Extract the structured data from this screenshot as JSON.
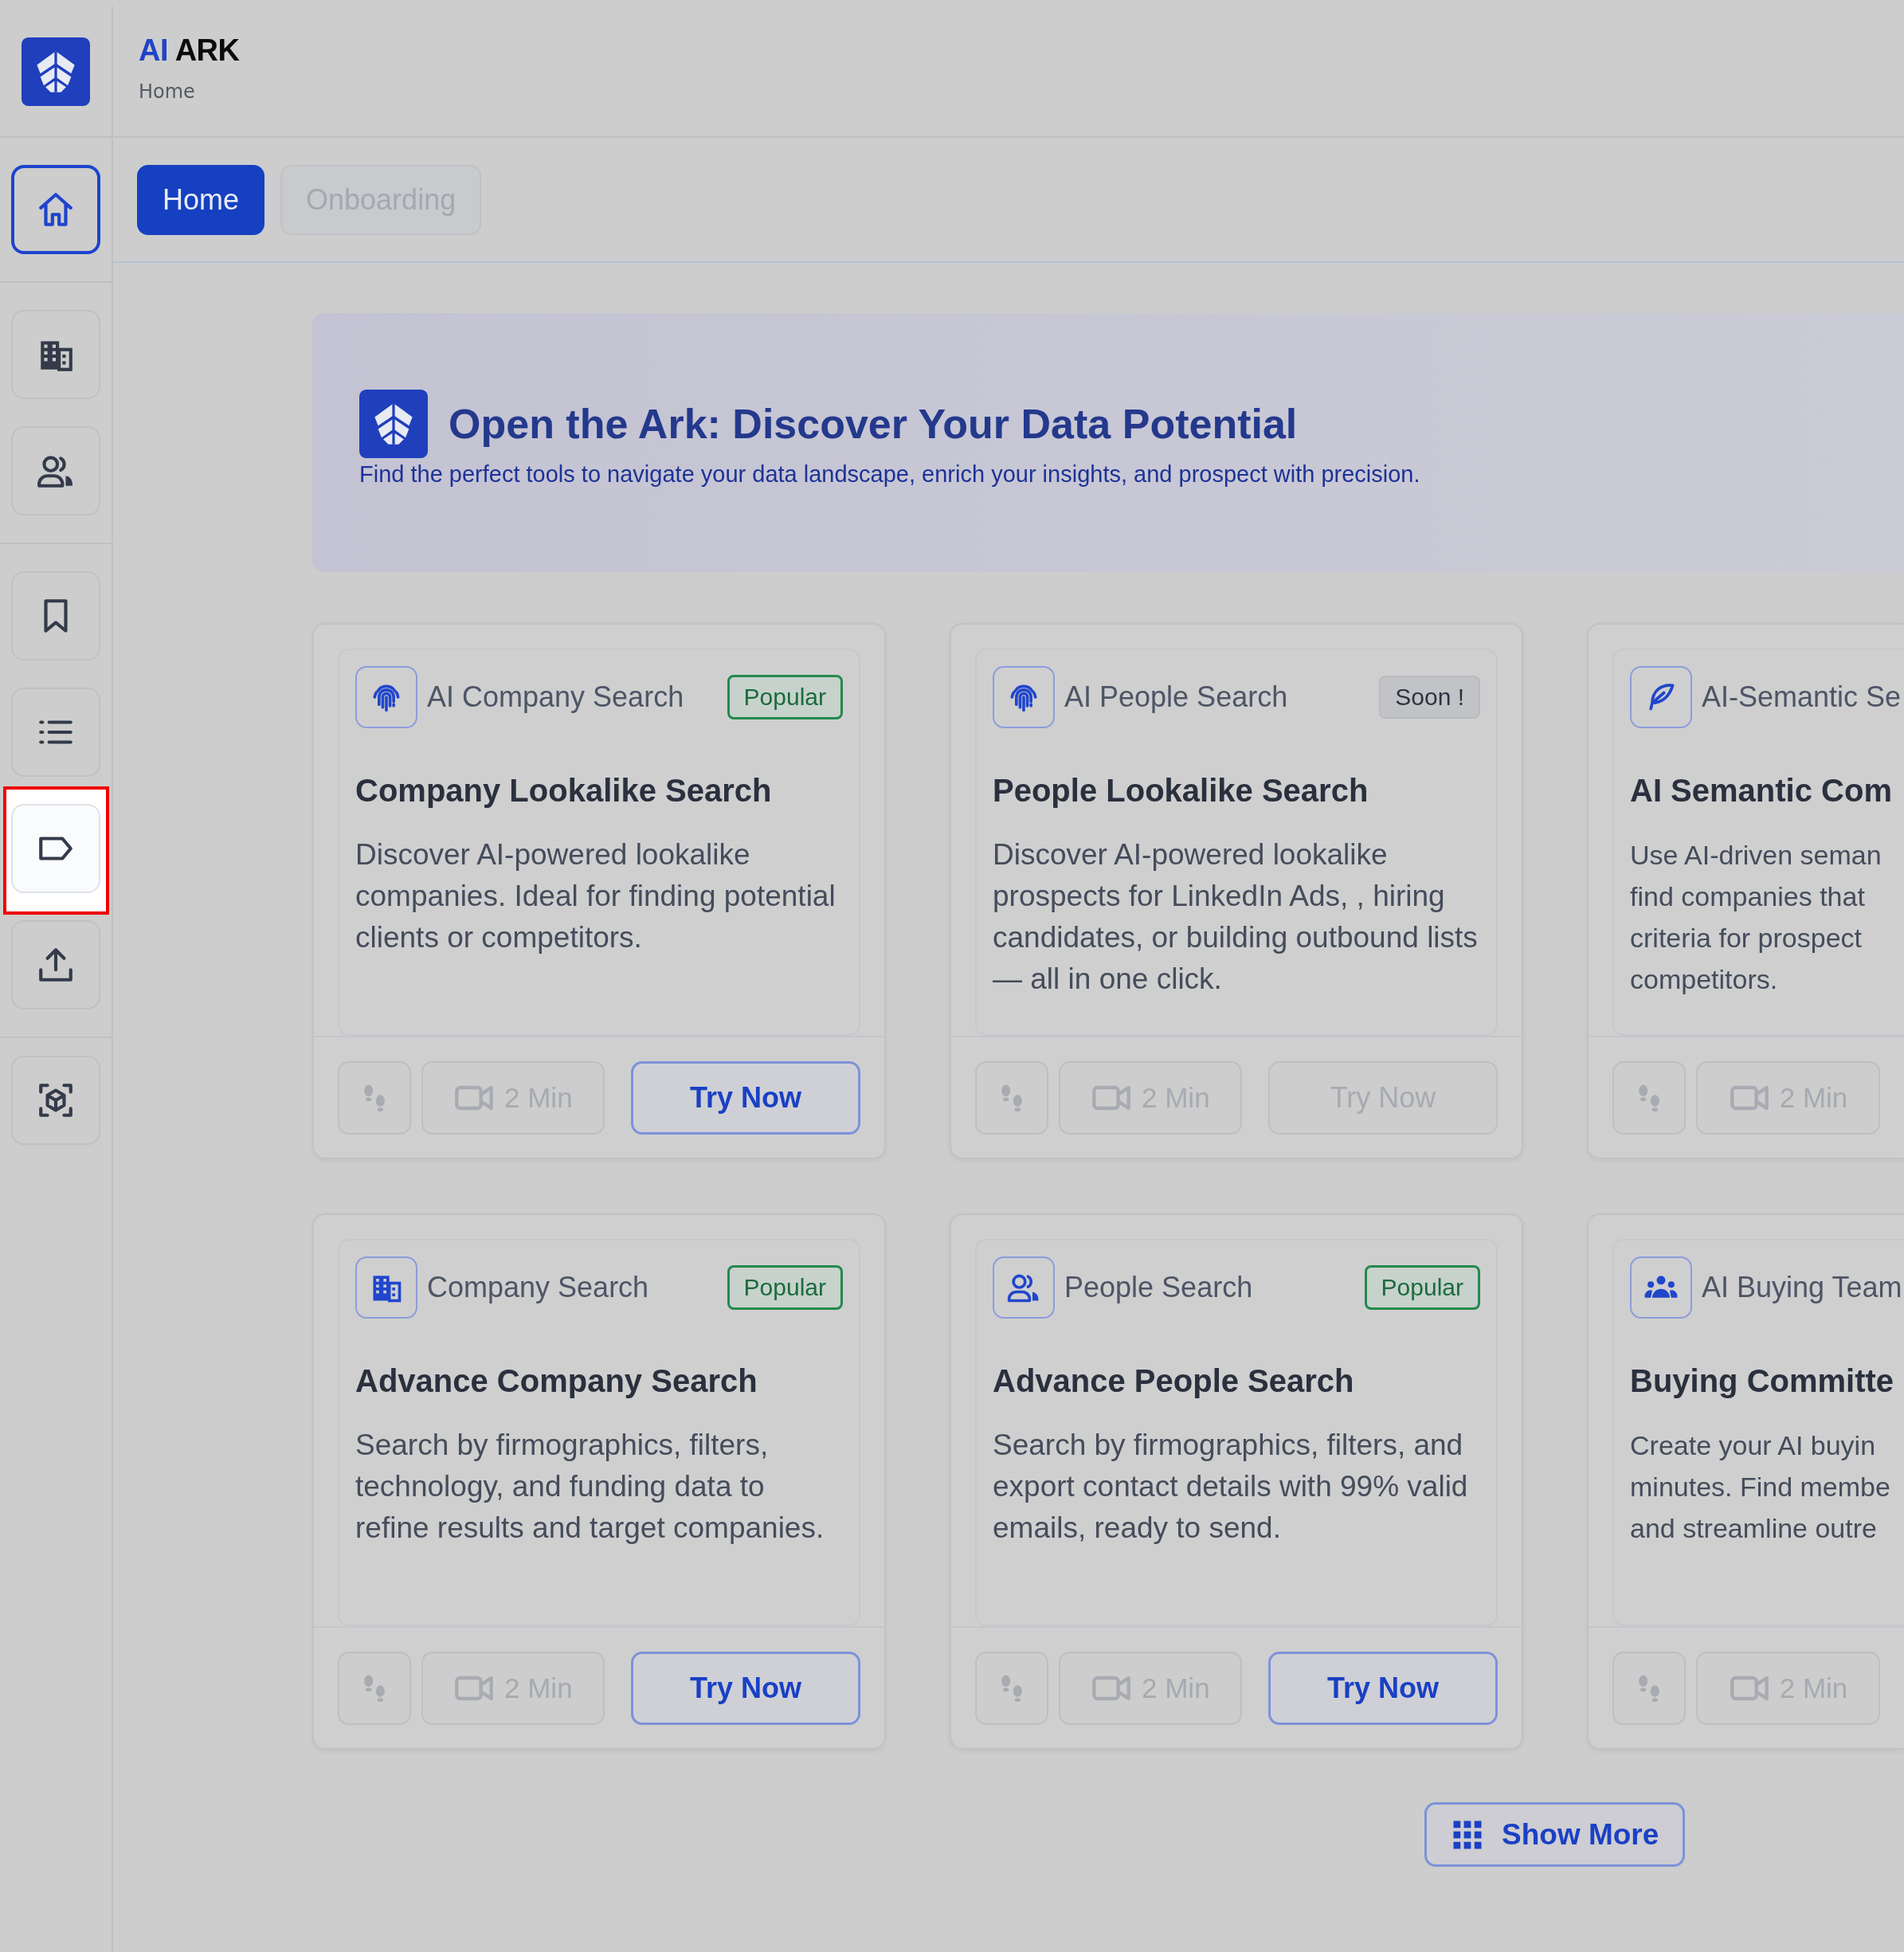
{
  "app": {
    "brand_prefix": "AI",
    "brand_name": "ARK",
    "breadcrumb": "Home"
  },
  "sidebar": {
    "groups": [
      {
        "items": [
          {
            "selected": true,
            "highlighted": false
          }
        ]
      },
      {
        "items": [
          {
            "selected": false,
            "highlighted": false
          },
          {
            "selected": false,
            "highlighted": false
          }
        ]
      },
      {
        "items": [
          {
            "selected": false,
            "highlighted": false
          },
          {
            "selected": false,
            "highlighted": false
          },
          {
            "selected": false,
            "highlighted": true
          },
          {
            "selected": false,
            "highlighted": false
          }
        ]
      },
      {
        "items": [
          {
            "selected": false,
            "highlighted": false
          }
        ]
      }
    ]
  },
  "tabs": [
    {
      "label": "Home",
      "selected": true
    },
    {
      "label": "Onboarding",
      "selected": false
    }
  ],
  "banner": {
    "title": "Open the Ark: Discover Your Data Potential",
    "subtitle": "Find the perfect tools to navigate your data landscape, enrich your insights, and prospect with precision."
  },
  "cards": [
    {
      "category": "AI Company Search",
      "badge": {
        "label": "Popular",
        "kind": "popular"
      },
      "title": "Company Lookalike Search",
      "description": "Discover AI-powered lookalike companies. Ideal for finding potential clients or competitors.",
      "duration": "2 Min",
      "action": {
        "label": "Try Now",
        "disabled": false
      }
    },
    {
      "category": "AI People Search",
      "badge": {
        "label": "Soon !",
        "kind": "soon"
      },
      "title": "People Lookalike Search",
      "description": "Discover AI-powered lookalike prospects for LinkedIn Ads, , hiring candidates, or building outbound lists — all in one click.",
      "duration": "2 Min",
      "action": {
        "label": "Try Now",
        "disabled": true
      }
    },
    {
      "category": "AI-Semantic Se",
      "title": "AI Semantic Com",
      "description": "Use AI-driven seman\nfind companies that\ncriteria for prospect\ncompetitors.",
      "duration": "2 Min"
    },
    {
      "category": "Company Search",
      "badge": {
        "label": "Popular",
        "kind": "popular"
      },
      "title": "Advance Company Search",
      "description": "Search by firmographics, filters, technology, and funding data to refine results and target companies.",
      "duration": "2 Min",
      "action": {
        "label": "Try Now",
        "disabled": false
      }
    },
    {
      "category": "People Search",
      "badge": {
        "label": "Popular",
        "kind": "popular"
      },
      "title": "Advance People Search",
      "description": "Search by firmographics, filters, and export contact details with 99% valid emails, ready to send.",
      "duration": "2 Min",
      "action": {
        "label": "Try Now",
        "disabled": false
      }
    },
    {
      "category": "AI Buying Team",
      "title": "Buying Committe",
      "description": "Create your AI buyin\nminutes. Find membe\nand streamline outre",
      "duration": "2 Min"
    }
  ],
  "show_more": {
    "label": "Show More"
  }
}
